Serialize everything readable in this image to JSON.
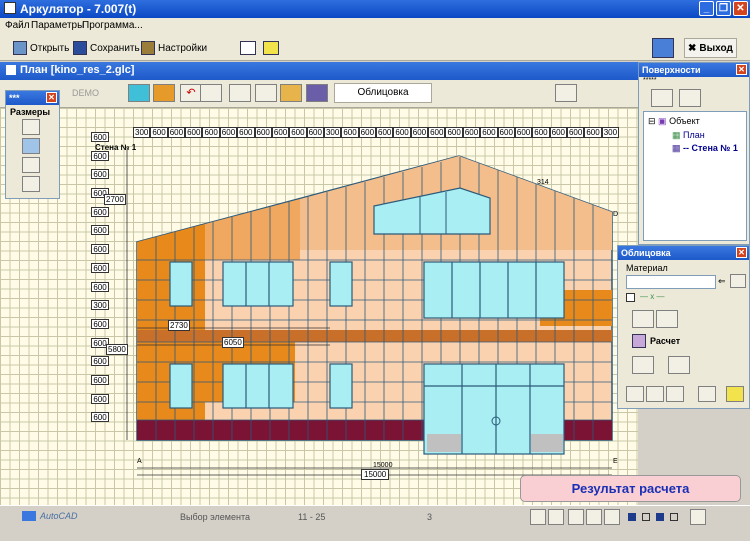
{
  "window": {
    "title": "Аркулятор - 7.007(t)"
  },
  "menu": [
    "Файл",
    "Параметры",
    "Программа..."
  ],
  "toolbar": {
    "open": "Открыть",
    "save": "Сохранить",
    "settings": "Настройки",
    "exit": "Выход"
  },
  "document": {
    "title": "План [kino_res_2.glc]",
    "demo": "DEMO",
    "facing_button": "Облицовка"
  },
  "sizes_panel": {
    "title": "***",
    "label": "Размеры"
  },
  "drawing": {
    "wall_label": "Стена № 1",
    "ruler_top": [
      "300",
      "600",
      "600",
      "600",
      "600",
      "600",
      "600",
      "600",
      "600",
      "600",
      "600",
      "300",
      "600",
      "600",
      "600",
      "600",
      "600",
      "600",
      "600",
      "600",
      "600",
      "600",
      "600",
      "600",
      "600",
      "600",
      "600",
      "300"
    ],
    "ruler_left": [
      "600",
      "600",
      "600",
      "600",
      "600",
      "600",
      "600",
      "600",
      "600",
      "300",
      "600",
      "600",
      "600",
      "600",
      "600",
      "600"
    ],
    "dims": {
      "d2700": "2700",
      "d5800": "5800",
      "d2730": "2730",
      "d6050": "6050",
      "d15000": "15000",
      "d15000b": "15000",
      "d314": "314"
    },
    "letters": {
      "a": "A",
      "e": "E",
      "d": "D"
    }
  },
  "surfaces_panel": {
    "title": "Поверхности",
    "stars": "*****",
    "tree": {
      "root": "Объект",
      "plan": "План",
      "wall": "-- Стена № 1"
    }
  },
  "facing_panel": {
    "title": "Облицовка",
    "material_label": "Материал",
    "material_value": "",
    "line_label": "— x —",
    "calc": "Расчет"
  },
  "result_button": "Результат расчета",
  "status": {
    "autocad": "AutoCAD",
    "message": "Выбор элемента",
    "range": "11 - 25",
    "count": "3"
  },
  "colors": {
    "orange": "#e8891c",
    "light_orange": "#f4bd8c",
    "peach": "#fbd2b0",
    "maroon": "#7a1334",
    "glass": "#a8eef2",
    "brown_band": "#c8702a"
  }
}
